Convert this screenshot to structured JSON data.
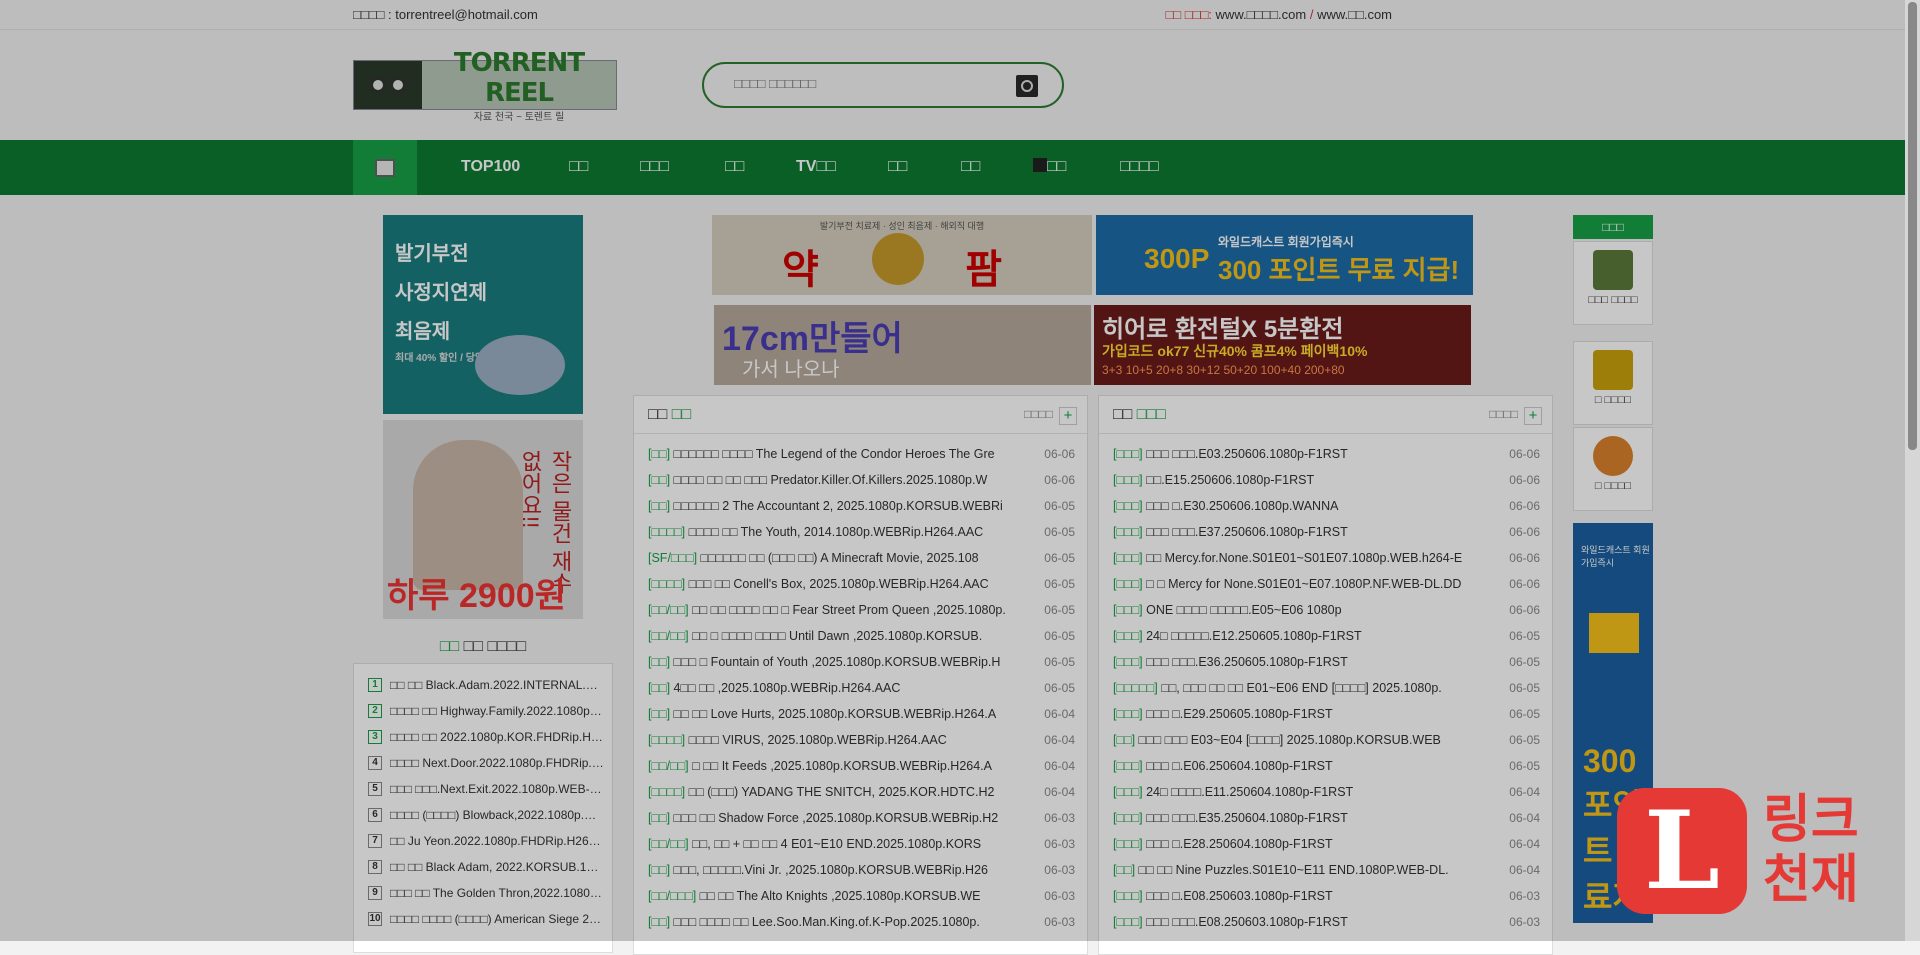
{
  "topbar": {
    "contact": "□□□□ : torrentreel@hotmail.com",
    "addr_label": "□□ □□□:",
    "addr1": "www.□□□□.com",
    "sep": "/",
    "addr2": "www.□□.com"
  },
  "logo": {
    "name": "TORRENT REEL",
    "tagline": "자료 천국 ~ 토렌트 릴"
  },
  "search": {
    "placeholder": "□□□□ □□□□□□"
  },
  "nav": {
    "items": [
      "TOP100",
      "□□",
      "□□□",
      "□□",
      "TV□□",
      "□□",
      "□□",
      "□□",
      "□□□□"
    ]
  },
  "left_ads": {
    "ad1": {
      "lines": [
        "발기부전",
        "사정지연제",
        "최음제"
      ],
      "small": "최대 40% 할인 / 당일배송"
    },
    "ad2": {
      "side": "작은 물건 재수 없어요!!",
      "bottom": "하루 2900원"
    }
  },
  "popular": {
    "title_green": "□□",
    "title_rest": "□□ □□□□",
    "rows": [
      {
        "n": "1",
        "t": "□□ □□ Black.Adam.2022.INTERNAL.1080p"
      },
      {
        "n": "2",
        "t": "□□□□ □□ Highway.Family.2022.1080p.WEB"
      },
      {
        "n": "3",
        "t": "□□□□ □□ 2022.1080p.KOR.FHDRip.H264"
      },
      {
        "n": "4",
        "t": "□□□□ Next.Door.2022.1080p.FHDRip.H264"
      },
      {
        "n": "5",
        "t": "□□□ □□□.Next.Exit.2022.1080p.WEB-DL"
      },
      {
        "n": "6",
        "t": "□□□□ (□□□□) Blowback,2022.1080p.WEB"
      },
      {
        "n": "7",
        "t": "□□ Ju Yeon.2022.1080p.FHDRip.H264.AAC"
      },
      {
        "n": "8",
        "t": "□□ □□ Black Adam, 2022.KORSUB.1080p"
      },
      {
        "n": "9",
        "t": "□□□ □□ The Golden Thron,2022.1080p.WEB"
      },
      {
        "n": "10",
        "t": "□□□□ □□□□ (□□□□) American Siege 2022"
      }
    ]
  },
  "banners": {
    "b1": {
      "top": "발기부전 치료제 · 성인 최음제 · 해외직 대행",
      "left": "약",
      "right": "팜"
    },
    "b2": {
      "yl": "300P",
      "msg": "300 포인트 무료 지급!",
      "small": "와일드캐스트 회원가입즉시"
    },
    "b3": {
      "t1": "17cm만들어",
      "t2": "가서 나오나"
    },
    "b4": {
      "t1": "히어로 환전털X 5분환전",
      "t2": "가입코드 ok77 신규40% 콤프4% 페이백10%",
      "t3": "3+3 10+5 20+8 30+12 50+20 100+40 200+80"
    }
  },
  "board_movie": {
    "title_a": "□□",
    "title_b": "□□",
    "more": "□□□□",
    "plus": "+",
    "rows": [
      {
        "c": "[□□]",
        "t": "□□□□□□ □□□□ The Legend of the Condor Heroes The Gre",
        "d": "06-06"
      },
      {
        "c": "[□□]",
        "t": "□□□□ □□ □□ □□□ Predator.Killer.Of.Killers.2025.1080p.W",
        "d": "06-06"
      },
      {
        "c": "[□□]",
        "t": "□□□□□□ 2 The Accountant 2, 2025.1080p.KORSUB.WEBRi",
        "d": "06-05"
      },
      {
        "c": "[□□□□]",
        "t": "□□□□ □□ The Youth, 2014.1080p.WEBRip.H264.AAC",
        "d": "06-05"
      },
      {
        "c": "[SF/□□□]",
        "t": "□□□□□□ □□ (□□□ □□) A Minecraft Movie, 2025.108",
        "d": "06-05"
      },
      {
        "c": "[□□□□]",
        "t": "□□□ □□ Conell's Box, 2025.1080p.WEBRip.H264.AAC",
        "d": "06-05"
      },
      {
        "c": "[□□/□□]",
        "t": "□□ □□ □□□□ □□ □ Fear Street Prom Queen ,2025.1080p.",
        "d": "06-05"
      },
      {
        "c": "[□□/□□]",
        "t": "□□ □ □□□□ □□□□ Until Dawn ,2025.1080p.KORSUB.",
        "d": "06-05"
      },
      {
        "c": "[□□]",
        "t": "□□□ □ Fountain of Youth ,2025.1080p.KORSUB.WEBRip.H",
        "d": "06-05"
      },
      {
        "c": "[□□]",
        "t": "4□□ □□ ,2025.1080p.WEBRip.H264.AAC",
        "d": "06-05"
      },
      {
        "c": "[□□]",
        "t": "□□ □□ Love Hurts, 2025.1080p.KORSUB.WEBRip.H264.A",
        "d": "06-04"
      },
      {
        "c": "[□□□□]",
        "t": "□□□□ VIRUS, 2025.1080p.WEBRip.H264.AAC",
        "d": "06-04"
      },
      {
        "c": "[□□/□□]",
        "t": "□ □□ It Feeds ,2025.1080p.KORSUB.WEBRip.H264.A",
        "d": "06-04"
      },
      {
        "c": "[□□□□]",
        "t": "□□ (□□□) YADANG THE SNITCH, 2025.KOR.HDTC.H2",
        "d": "06-04"
      },
      {
        "c": "[□□]",
        "t": "□□□ □□ Shadow Force ,2025.1080p.KORSUB.WEBRip.H2",
        "d": "06-03"
      },
      {
        "c": "[□□/□□]",
        "t": "□□, □□ + □□ □□ 4 E01~E10 END.2025.1080p.KORS",
        "d": "06-03"
      },
      {
        "c": "[□□]",
        "t": "□□□, □□□□□.Vini Jr. ,2025.1080p.KORSUB.WEBRip.H26",
        "d": "06-03"
      },
      {
        "c": "[□□/□□□]",
        "t": "□□ □□ The Alto Knights ,2025.1080p.KORSUB.WE",
        "d": "06-03"
      },
      {
        "c": "[□□]",
        "t": "□□□ □□□□ □□ Lee.Soo.Man.King.of.K-Pop.2025.1080p.",
        "d": "06-03"
      }
    ]
  },
  "board_drama": {
    "title_a": "□□",
    "title_b": "□□□",
    "more": "□□□□",
    "plus": "+",
    "rows": [
      {
        "c": "[□□□]",
        "t": "□□□ □□□.E03.250606.1080p-F1RST",
        "d": "06-06"
      },
      {
        "c": "[□□□]",
        "t": "□□.E15.250606.1080p-F1RST",
        "d": "06-06"
      },
      {
        "c": "[□□□]",
        "t": "□□□ □.E30.250606.1080p.WANNA",
        "d": "06-06"
      },
      {
        "c": "[□□□]",
        "t": "□□□ □□□.E37.250606.1080p-F1RST",
        "d": "06-06"
      },
      {
        "c": "[□□□]",
        "t": "□□ Mercy.for.None.S01E01~S01E07.1080p.WEB.h264-E",
        "d": "06-06"
      },
      {
        "c": "[□□□]",
        "t": "□ □ Mercy for None.S01E01~E07.1080P.NF.WEB-DL.DD",
        "d": "06-06"
      },
      {
        "c": "[□□□]",
        "t": "ONE □□□□ □□□□□.E05~E06 1080p",
        "d": "06-06"
      },
      {
        "c": "[□□□]",
        "t": "24□ □□□□□.E12.250605.1080p-F1RST",
        "d": "06-05"
      },
      {
        "c": "[□□□]",
        "t": "□□□ □□□.E36.250605.1080p-F1RST",
        "d": "06-05"
      },
      {
        "c": "[□□□□□]",
        "t": "□□, □□□ □□ □□ E01~E06 END [□□□□] 2025.1080p.",
        "d": "06-05"
      },
      {
        "c": "[□□□]",
        "t": "□□□ □.E29.250605.1080p-F1RST",
        "d": "06-05"
      },
      {
        "c": "[□□]",
        "t": "□□□ □□□ E03~E04 [□□□□] 2025.1080p.KORSUB.WEB",
        "d": "06-05"
      },
      {
        "c": "[□□□]",
        "t": "□□□ □.E06.250604.1080p-F1RST",
        "d": "06-05"
      },
      {
        "c": "[□□□]",
        "t": "24□ □□□□.E11.250604.1080p-F1RST",
        "d": "06-04"
      },
      {
        "c": "[□□□]",
        "t": "□□□ □□□.E35.250604.1080p-F1RST",
        "d": "06-04"
      },
      {
        "c": "[□□□]",
        "t": "□□□ □.E28.250604.1080p-F1RST",
        "d": "06-04"
      },
      {
        "c": "[□□]",
        "t": "□□ □□ Nine Puzzles.S01E10~E11 END.1080P.WEB-DL.",
        "d": "06-04"
      },
      {
        "c": "[□□□]",
        "t": "□□□ □.E08.250603.1080p-F1RST",
        "d": "06-03"
      },
      {
        "c": "[□□□]",
        "t": "□□□ □□□.E08.250603.1080p-F1RST",
        "d": "06-03"
      }
    ]
  },
  "right_sidebar": {
    "header": "□□□",
    "boxes": [
      {
        "label": "□□□ □□□□",
        "color": "#5b7a3a"
      },
      {
        "label": "□ □□□□",
        "color": "#c9a20c"
      },
      {
        "label": "□ □□□□",
        "color": "#d9822b"
      }
    ],
    "ad_msg": "와일드캐스트 회원가입즉시",
    "ad_big": "300 포인트 무료지급"
  },
  "float_logo": {
    "letter": "L",
    "word1": "링크",
    "word2": "천재"
  },
  "colors": {
    "brand_green": "#0d7a31",
    "accent_red": "#e53935"
  }
}
